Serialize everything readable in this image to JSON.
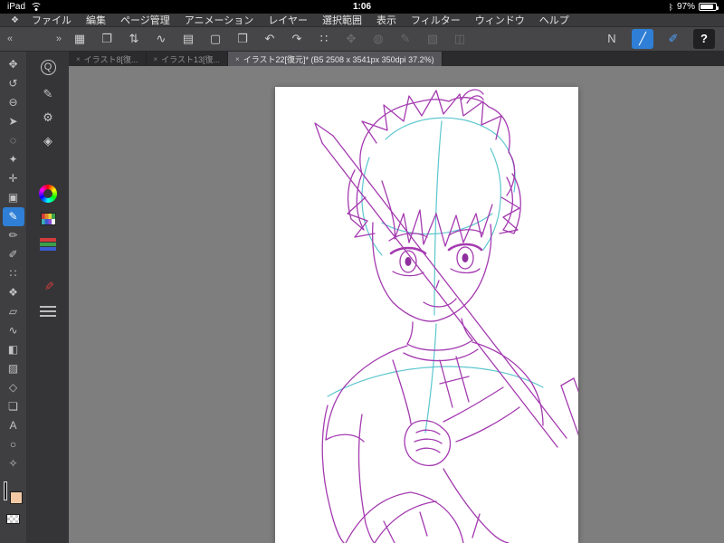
{
  "status_bar": {
    "device": "iPad",
    "time": "1:06",
    "battery_percent": "97%",
    "bluetooth_glyph": "ᛒ"
  },
  "menu_bar": {
    "app_glyph": "❖",
    "items": [
      {
        "name": "menu-file",
        "label": "ファイル"
      },
      {
        "name": "menu-edit",
        "label": "編集"
      },
      {
        "name": "menu-page-manage",
        "label": "ページ管理"
      },
      {
        "name": "menu-animation",
        "label": "アニメーション"
      },
      {
        "name": "menu-layer",
        "label": "レイヤー"
      },
      {
        "name": "menu-selection",
        "label": "選択範囲"
      },
      {
        "name": "menu-view",
        "label": "表示"
      },
      {
        "name": "menu-filter",
        "label": "フィルター"
      },
      {
        "name": "menu-window",
        "label": "ウィンドウ"
      },
      {
        "name": "menu-help",
        "label": "ヘルプ"
      }
    ]
  },
  "toolbar": {
    "collapse_left_glyph": "«",
    "collapse_right_glyph": "»",
    "left_items": [
      {
        "name": "workspace-grid-button",
        "glyph": "▦"
      },
      {
        "name": "canvas-export-button",
        "glyph": "❐"
      },
      {
        "name": "swap-tool-button",
        "glyph": "⇅"
      },
      {
        "name": "stream-line-button",
        "glyph": "∿"
      },
      {
        "name": "new-page-button",
        "glyph": "▤"
      },
      {
        "name": "page-template-button",
        "glyph": "▢"
      },
      {
        "name": "page-manage-button",
        "glyph": "❒"
      },
      {
        "name": "undo-button",
        "glyph": "↶"
      },
      {
        "name": "redo-button",
        "glyph": "↷"
      },
      {
        "name": "snap-button",
        "glyph": "∷"
      },
      {
        "name": "transform-button",
        "glyph": "✥",
        "state": "disabled"
      },
      {
        "name": "reference-button",
        "glyph": "◍",
        "state": "disabled"
      },
      {
        "name": "edit-line-button",
        "glyph": "✎",
        "state": "disabled"
      },
      {
        "name": "pattern-button",
        "glyph": "▧",
        "state": "disabled"
      },
      {
        "name": "material-button",
        "glyph": "◫",
        "state": "disabled"
      }
    ],
    "right_items": [
      {
        "name": "pen-n-button",
        "glyph": "N"
      },
      {
        "name": "line-correction-button",
        "glyph": "╱",
        "state": "active"
      },
      {
        "name": "brush-blue-button",
        "glyph": "✐",
        "state": "accent"
      },
      {
        "name": "help-button",
        "glyph": "?",
        "state": "dark"
      }
    ]
  },
  "tab_bar": {
    "tabs": [
      {
        "name": "tab-illust-8",
        "label": "イラスト8[復...",
        "close_glyph": "×",
        "active": false
      },
      {
        "name": "tab-illust-13",
        "label": "イラスト13[復...",
        "close_glyph": "×",
        "active": false
      },
      {
        "name": "tab-illust-22",
        "label": "イラスト22[復元]* (B5 2508 x 3541px 350dpi 37.2%)",
        "close_glyph": "×",
        "active": true
      }
    ]
  },
  "sidebar": {
    "tools": [
      {
        "name": "hand-tool",
        "glyph": "✥"
      },
      {
        "name": "rotate-canvas-tool",
        "glyph": "↺"
      },
      {
        "name": "zoom-tool",
        "glyph": "⊖"
      },
      {
        "name": "object-tool",
        "glyph": "➤"
      },
      {
        "name": "lasso-tool",
        "glyph": "◌"
      },
      {
        "name": "wand-tool",
        "glyph": "✦"
      },
      {
        "name": "move-layer-tool",
        "glyph": "✛"
      },
      {
        "name": "crop-tool",
        "glyph": "▣"
      },
      {
        "name": "pen-tool",
        "glyph": "✎",
        "active": true
      },
      {
        "name": "pencil-tool",
        "glyph": "✏"
      },
      {
        "name": "brush-tool",
        "glyph": "✐"
      },
      {
        "name": "airbrush-tool",
        "glyph": "∷"
      },
      {
        "name": "decoration-tool",
        "glyph": "❖"
      },
      {
        "name": "eraser-tool",
        "glyph": "▱"
      },
      {
        "name": "blend-tool",
        "glyph": "∿"
      },
      {
        "name": "fill-tool",
        "glyph": "◧"
      },
      {
        "name": "gradient-tool",
        "glyph": "▨"
      },
      {
        "name": "figure-tool",
        "glyph": "◇"
      },
      {
        "name": "frame-border-tool",
        "glyph": "❏"
      },
      {
        "name": "text-tool",
        "glyph": "A"
      },
      {
        "name": "balloon-tool",
        "glyph": "○"
      },
      {
        "name": "eyedropper-tool",
        "glyph": "✧"
      }
    ],
    "panels": {
      "quick_access_glyph": "Q",
      "sub_tool_glyph": "✎",
      "settings_glyph": "⚙",
      "navigator_glyph": "◈",
      "mix_glyph": "✎"
    },
    "colors": {
      "main": "#7b3f8f",
      "sub": "#f2c9a4"
    }
  },
  "canvas": {
    "background": "#7e7e7e",
    "page_color": "#ffffff",
    "sketch_line_color": "#a43bb0",
    "sketch_guide_color": "#5cc6ce"
  }
}
